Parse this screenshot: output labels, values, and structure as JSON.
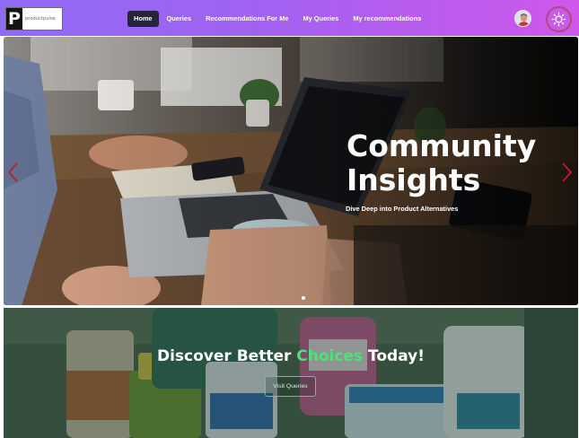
{
  "navbar": {
    "logo_letter": "P",
    "logo_text": "productpulse",
    "links": [
      {
        "label": "Home",
        "active": true
      },
      {
        "label": "Queries",
        "active": false
      },
      {
        "label": "Recommendations For Me",
        "active": false
      },
      {
        "label": "My Queries",
        "active": false
      },
      {
        "label": "My recommendations",
        "active": false
      }
    ],
    "avatar_icon": "user-avatar",
    "theme_toggle_icon": "sun-icon"
  },
  "hero": {
    "title": "Community Insights",
    "subtitle": "Dive Deep into Product Alternatives",
    "prev_icon": "chevron-left-icon",
    "next_icon": "chevron-right-icon",
    "slide_count": 1,
    "active_slide": 0
  },
  "promo": {
    "heading_before": "Discover Better ",
    "heading_accent": "Choices",
    "heading_after": " Today!",
    "button_label": "Visit Queries"
  },
  "colors": {
    "nav_gradient_start": "#8f6bf5",
    "nav_gradient_end": "#cf57ec",
    "active_nav_bg": "#25243a",
    "chevron": "#c51a2c",
    "accent_green": "#4ee07a",
    "theme_toggle_ring": "#b04a7c"
  }
}
